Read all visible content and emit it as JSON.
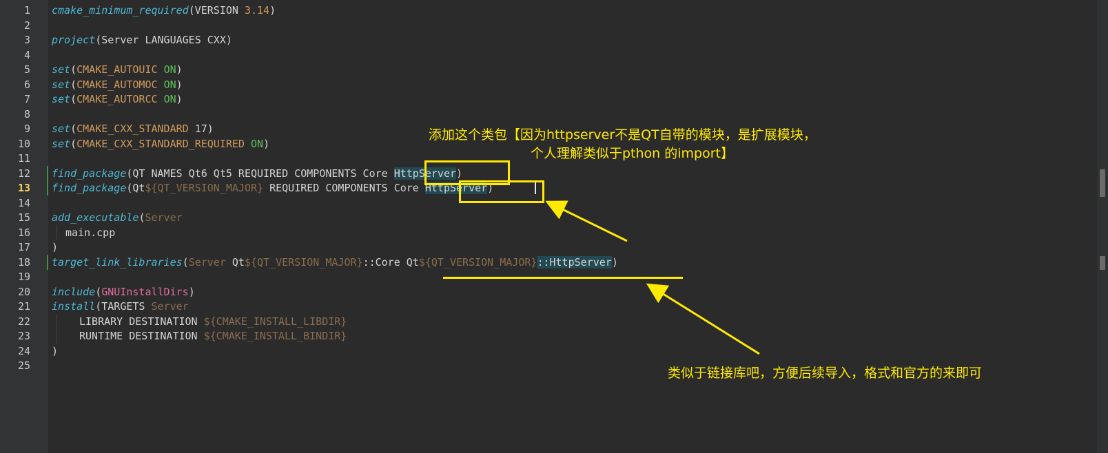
{
  "editor": {
    "current_line": 13,
    "lines": [
      {
        "n": "1"
      },
      {
        "n": "2"
      },
      {
        "n": "3"
      },
      {
        "n": "4"
      },
      {
        "n": "5"
      },
      {
        "n": "6"
      },
      {
        "n": "7"
      },
      {
        "n": "8"
      },
      {
        "n": "9"
      },
      {
        "n": "10"
      },
      {
        "n": "11"
      },
      {
        "n": "12"
      },
      {
        "n": "13"
      },
      {
        "n": "14"
      },
      {
        "n": "15"
      },
      {
        "n": "16"
      },
      {
        "n": "17"
      },
      {
        "n": "18"
      },
      {
        "n": "19"
      },
      {
        "n": "20"
      },
      {
        "n": "21"
      },
      {
        "n": "22"
      },
      {
        "n": "23"
      },
      {
        "n": "24"
      },
      {
        "n": "25"
      }
    ],
    "code": {
      "l1": {
        "fn": "cmake_minimum_required",
        "open": "(VERSION ",
        "num": "3.14",
        "close": ")"
      },
      "l3": {
        "fn": "project",
        "rest": "(Server LANGUAGES CXX)"
      },
      "l5": {
        "fn": "set",
        "open": "(",
        "var": "CMAKE_AUTOUIC",
        "on": "ON",
        "close": ")"
      },
      "l6": {
        "fn": "set",
        "open": "(",
        "var": "CMAKE_AUTOMOC",
        "on": "ON",
        "close": ")"
      },
      "l7": {
        "fn": "set",
        "open": "(",
        "var": "CMAKE_AUTORCC",
        "on": "ON",
        "close": ")"
      },
      "l9": {
        "fn": "set",
        "open": "(",
        "var": "CMAKE_CXX_STANDARD",
        "num": "17",
        "close": ")"
      },
      "l10": {
        "fn": "set",
        "open": "(",
        "var": "CMAKE_CXX_STANDARD_REQUIRED",
        "on": "ON",
        "close": ")"
      },
      "l12": {
        "fn": "find_package",
        "rest": "(QT NAMES Qt6 Qt5 REQUIRED COMPONENTS Core ",
        "hl": "HttpServer",
        "close": ")"
      },
      "l13": {
        "fn": "find_package",
        "open": "(Qt",
        "dim": "${QT_VERSION_MAJOR}",
        "rest": " REQUIRED COMPONENTS Core ",
        "hl": "HttpServer",
        "close": ")"
      },
      "l15": {
        "fn": "add_executable",
        "open": "(",
        "dim": "Server"
      },
      "l16": {
        "text": "main.cpp"
      },
      "l17": {
        "text": ")"
      },
      "l18": {
        "fn": "target_link_libraries",
        "open": "(",
        "dim1": "Server",
        "t1": " Qt",
        "dim2": "${QT_VERSION_MAJOR}",
        "t2": "::Core Qt",
        "dim3": "${QT_VERSION_MAJOR}",
        "hl": "::HttpServer",
        "close": ")"
      },
      "l20": {
        "fn": "include",
        "open": "(",
        "pink": "GNUInstallDirs",
        "close": ")"
      },
      "l21": {
        "fn": "install",
        "open": "(TARGETS ",
        "dim": "Server"
      },
      "l22": {
        "text": "LIBRARY DESTINATION ",
        "dim": "${CMAKE_INSTALL_LIBDIR}"
      },
      "l23": {
        "text": "RUNTIME DESTINATION ",
        "dim": "${CMAKE_INSTALL_BINDIR}"
      },
      "l24": {
        "text": ")"
      }
    }
  },
  "annotations": {
    "top_line1": "添加这个类包【因为httpserver不是QT自带的模块，是扩展模块，",
    "top_line2": "个人理解类似于pthon 的import】",
    "bottom": "类似于链接库吧，方便后续导入，格式和官方的来即可"
  },
  "colors": {
    "annotation": "#ffea00",
    "function": "#4fb8d6",
    "variable": "#d19a5b",
    "keyword_on": "#5fbf58",
    "current_line_number": "#f6d55c"
  }
}
